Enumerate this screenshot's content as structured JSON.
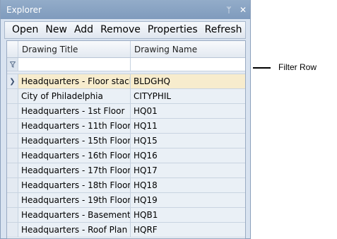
{
  "panel": {
    "title": "Explorer",
    "pin_glyph": "ᛘ",
    "close_glyph": "✕"
  },
  "toolbar": {
    "open": "Open",
    "new": "New",
    "add": "Add",
    "remove": "Remove",
    "properties": "Properties",
    "refresh": "Refresh"
  },
  "grid": {
    "columns": {
      "title": "Drawing Title",
      "name": "Drawing Name"
    },
    "filter_icon": "funnel-icon",
    "rows": [
      {
        "title": "Headquarters - Floor stack",
        "name": "BLDGHQ"
      },
      {
        "title": "City of Philadelphia",
        "name": "CITYPHIL"
      },
      {
        "title": "Headquarters - 1st Floor",
        "name": "HQ01"
      },
      {
        "title": "Headquarters - 11th Floor",
        "name": "HQ11"
      },
      {
        "title": "Headquarters - 15th Floor",
        "name": "HQ15"
      },
      {
        "title": "Headquarters - 16th Floor",
        "name": "HQ16"
      },
      {
        "title": "Headquarters - 17th Floor",
        "name": "HQ17"
      },
      {
        "title": "Headquarters - 18th Floor",
        "name": "HQ18"
      },
      {
        "title": "Headquarters - 19th Floor",
        "name": "HQ19"
      },
      {
        "title": "Headquarters - Basement",
        "name": "HQB1"
      },
      {
        "title": "Headquarters - Roof Plan",
        "name": "HQRF"
      }
    ]
  },
  "callout": {
    "label": "Filter Row"
  },
  "colors": {
    "titlebar": "#8aa4c4",
    "selected_row": "#f7eccd",
    "grid_row": "#eaf0f6"
  }
}
